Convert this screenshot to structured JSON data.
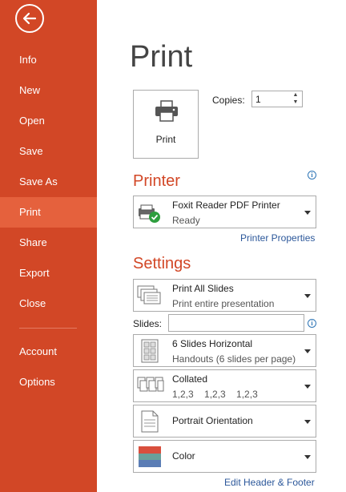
{
  "sidebar": {
    "items": [
      {
        "label": "Info"
      },
      {
        "label": "New"
      },
      {
        "label": "Open"
      },
      {
        "label": "Save"
      },
      {
        "label": "Save As"
      },
      {
        "label": "Print"
      },
      {
        "label": "Share"
      },
      {
        "label": "Export"
      },
      {
        "label": "Close"
      },
      {
        "label": "Account"
      },
      {
        "label": "Options"
      }
    ],
    "active": "Print",
    "background": "#d24726",
    "active_background": "#e5613d"
  },
  "main": {
    "title": "Print",
    "print_button_label": "Print",
    "copies_label": "Copies:",
    "copies_value": "1",
    "printer": {
      "heading": "Printer",
      "name": "Foxit Reader PDF Printer",
      "status": "Ready",
      "properties_link": "Printer Properties"
    },
    "settings": {
      "heading": "Settings",
      "range": {
        "title": "Print All Slides",
        "subtitle": "Print entire presentation"
      },
      "slides_label": "Slides:",
      "slides_value": "",
      "layout": {
        "title": "6 Slides Horizontal",
        "subtitle": "Handouts (6 slides per page)"
      },
      "collation": {
        "title": "Collated",
        "subtitle": "1,2,3    1,2,3    1,2,3"
      },
      "orientation": {
        "title": "Portrait Orientation"
      },
      "color": {
        "title": "Color"
      },
      "footer_link": "Edit Header & Footer"
    }
  },
  "colors": {
    "accent": "#d24726",
    "link": "#2b579a",
    "info": "#2e75b6"
  }
}
